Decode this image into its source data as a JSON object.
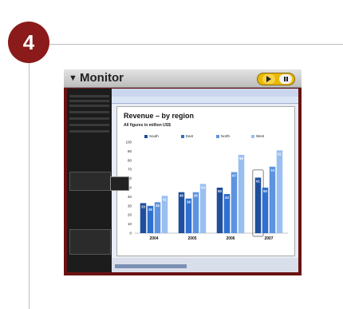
{
  "step": {
    "number": "4"
  },
  "monitor": {
    "title": "Monitor",
    "expand_icon": "triangle-down-icon",
    "play_icon": "play-icon",
    "pause_icon": "pause-icon"
  },
  "slide": {
    "title": "Revenue – by region",
    "subtitle": "All figures in million US$"
  },
  "colors": {
    "frame": "#6b1212",
    "badge": "#8b1a1a",
    "south": "#1f4e9c",
    "east": "#2f6fcf",
    "north": "#5d93e0",
    "west": "#98bff0"
  },
  "chart_data": {
    "type": "bar",
    "title": "Revenue – by region",
    "subtitle": "All figures in million US$",
    "categories": [
      "2004",
      "2005",
      "2006",
      "2007"
    ],
    "series": [
      {
        "name": "South",
        "values": [
          33,
          45,
          50,
          61
        ]
      },
      {
        "name": "East",
        "values": [
          30,
          38,
          43,
          50
        ]
      },
      {
        "name": "North",
        "values": [
          34,
          45,
          67,
          73
        ]
      },
      {
        "name": "West",
        "values": [
          41,
          54,
          86,
          91
        ]
      }
    ],
    "yticks": [
      "0",
      "10",
      "20",
      "30",
      "40",
      "50",
      "60",
      "70",
      "80",
      "90",
      "100"
    ],
    "ylim": [
      0,
      100
    ],
    "legend": "top",
    "grid": false,
    "highlight_category": "2007"
  }
}
